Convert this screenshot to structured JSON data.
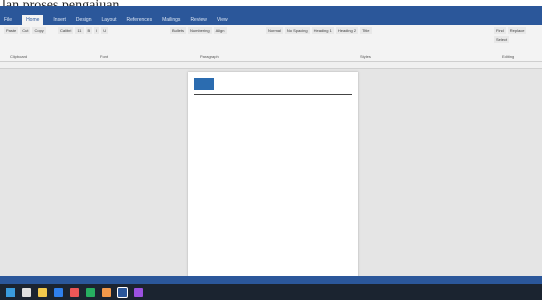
{
  "caption": "lan proses pengajuan",
  "ribbon_tabs": [
    "File",
    "Home",
    "Insert",
    "Design",
    "Layout",
    "References",
    "Mailings",
    "Review",
    "View"
  ],
  "ribbon_groups": [
    {
      "label": "Clipboard",
      "commands": [
        "Paste",
        "Cut",
        "Copy"
      ]
    },
    {
      "label": "Font",
      "commands": [
        "Calibri",
        "11",
        "B",
        "I",
        "U"
      ]
    },
    {
      "label": "Paragraph",
      "commands": [
        "Bullets",
        "Numbering",
        "Align"
      ]
    },
    {
      "label": "Styles",
      "commands": [
        "Normal",
        "No Spacing",
        "Heading 1",
        "Heading 2",
        "Title"
      ]
    },
    {
      "label": "Editing",
      "commands": [
        "Find",
        "Replace",
        "Select"
      ]
    }
  ],
  "page": {
    "logo": "",
    "header_lines": [
      "",
      "",
      ""
    ],
    "body_lines": [
      "",
      "",
      "",
      "",
      "",
      "",
      "",
      "",
      "",
      "",
      "",
      "",
      "",
      "",
      "",
      "",
      "",
      "",
      "",
      "",
      ""
    ],
    "table_rows": [
      [
        "",
        ""
      ],
      [
        "",
        ""
      ],
      [
        "",
        ""
      ]
    ]
  },
  "status": "",
  "taskbar_clock": "",
  "colors": {
    "word_blue": "#2b579a",
    "page_bg": "#ffffff",
    "canvas": "#e5e5e5"
  }
}
